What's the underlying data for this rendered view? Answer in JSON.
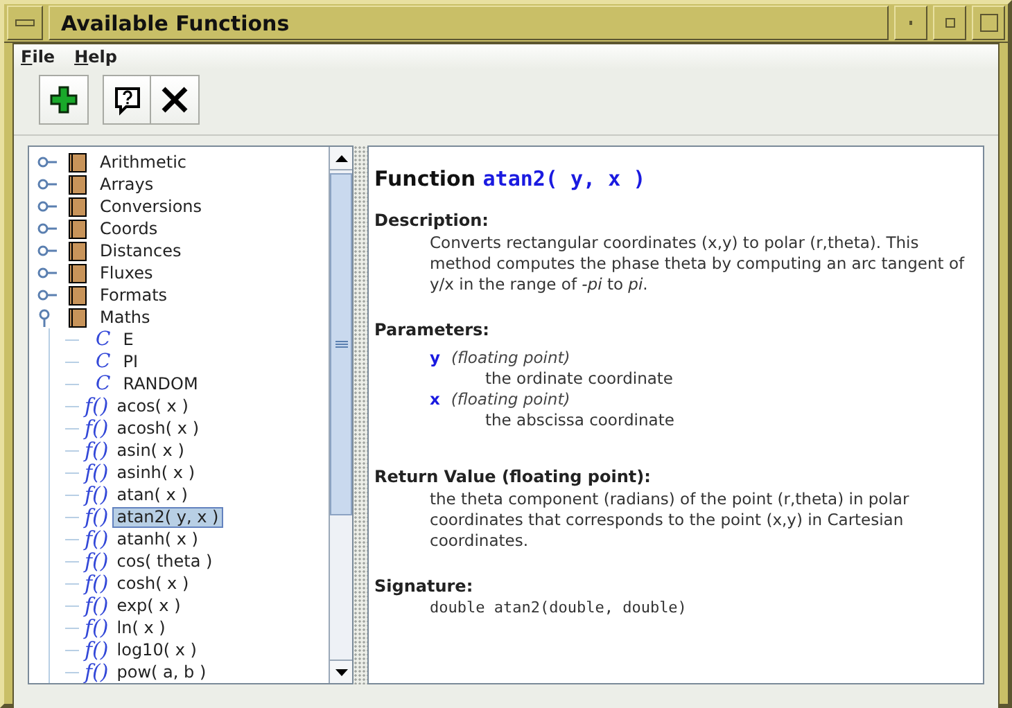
{
  "window": {
    "title": "Available Functions"
  },
  "menu": [
    {
      "label": "File"
    },
    {
      "label": "Help"
    }
  ],
  "toolbar": [
    {
      "kind": "add"
    },
    {
      "kind": "help"
    },
    {
      "kind": "close"
    }
  ],
  "tree": {
    "items": [
      {
        "label": "Arithmetic",
        "expanded": false
      },
      {
        "label": "Arrays",
        "expanded": false
      },
      {
        "label": "Conversions",
        "expanded": false
      },
      {
        "label": "Coords",
        "expanded": false
      },
      {
        "label": "Distances",
        "expanded": false
      },
      {
        "label": "Fluxes",
        "expanded": false
      },
      {
        "label": "Formats",
        "expanded": false
      },
      {
        "label": "Maths",
        "expanded": true,
        "children": [
          {
            "kind": "constant",
            "icon": "C",
            "label": "E",
            "selected": false
          },
          {
            "kind": "constant",
            "icon": "C",
            "label": "PI",
            "selected": false
          },
          {
            "kind": "constant",
            "icon": "C",
            "label": "RANDOM",
            "selected": false
          },
          {
            "kind": "function",
            "icon": "f()",
            "label": "acos( x )",
            "selected": false
          },
          {
            "kind": "function",
            "icon": "f()",
            "label": "acosh( x )",
            "selected": false
          },
          {
            "kind": "function",
            "icon": "f()",
            "label": "asin( x )",
            "selected": false
          },
          {
            "kind": "function",
            "icon": "f()",
            "label": "asinh( x )",
            "selected": false
          },
          {
            "kind": "function",
            "icon": "f()",
            "label": "atan( x )",
            "selected": false
          },
          {
            "kind": "function",
            "icon": "f()",
            "label": "atan2( y, x )",
            "selected": true
          },
          {
            "kind": "function",
            "icon": "f()",
            "label": "atanh( x )",
            "selected": false
          },
          {
            "kind": "function",
            "icon": "f()",
            "label": "cos( theta )",
            "selected": false
          },
          {
            "kind": "function",
            "icon": "f()",
            "label": "cosh( x )",
            "selected": false
          },
          {
            "kind": "function",
            "icon": "f()",
            "label": "exp( x )",
            "selected": false
          },
          {
            "kind": "function",
            "icon": "f()",
            "label": "ln( x )",
            "selected": false
          },
          {
            "kind": "function",
            "icon": "f()",
            "label": "log10( x )",
            "selected": false
          },
          {
            "kind": "function",
            "icon": "f()",
            "label": "pow( a, b )",
            "selected": false
          }
        ]
      }
    ]
  },
  "doc": {
    "title": "Function",
    "name": "atan2( y, x )",
    "sections": [
      {
        "kind": "text",
        "heading": "Description:",
        "body": "Converts rectangular coordinates (x,y) to polar (r,theta). This method computes the phase theta by computing an arc tangent of y/x in the range of *-pi* to *pi*."
      },
      {
        "kind": "params",
        "heading": "Parameters:",
        "params": [
          {
            "name": "y",
            "type": "(floating point)",
            "description": "the ordinate coordinate"
          },
          {
            "name": "x",
            "type": "(floating point)",
            "description": "the abscissa coordinate"
          }
        ]
      },
      {
        "kind": "text",
        "heading": "Return Value (floating point):",
        "body": "the theta component (radians) of the point (r,theta) in polar coordinates that corresponds to the point (x,y) in Cartesian coordinates."
      },
      {
        "kind": "code",
        "heading": "Signature:",
        "body": "double atan2(double, double)"
      }
    ]
  }
}
